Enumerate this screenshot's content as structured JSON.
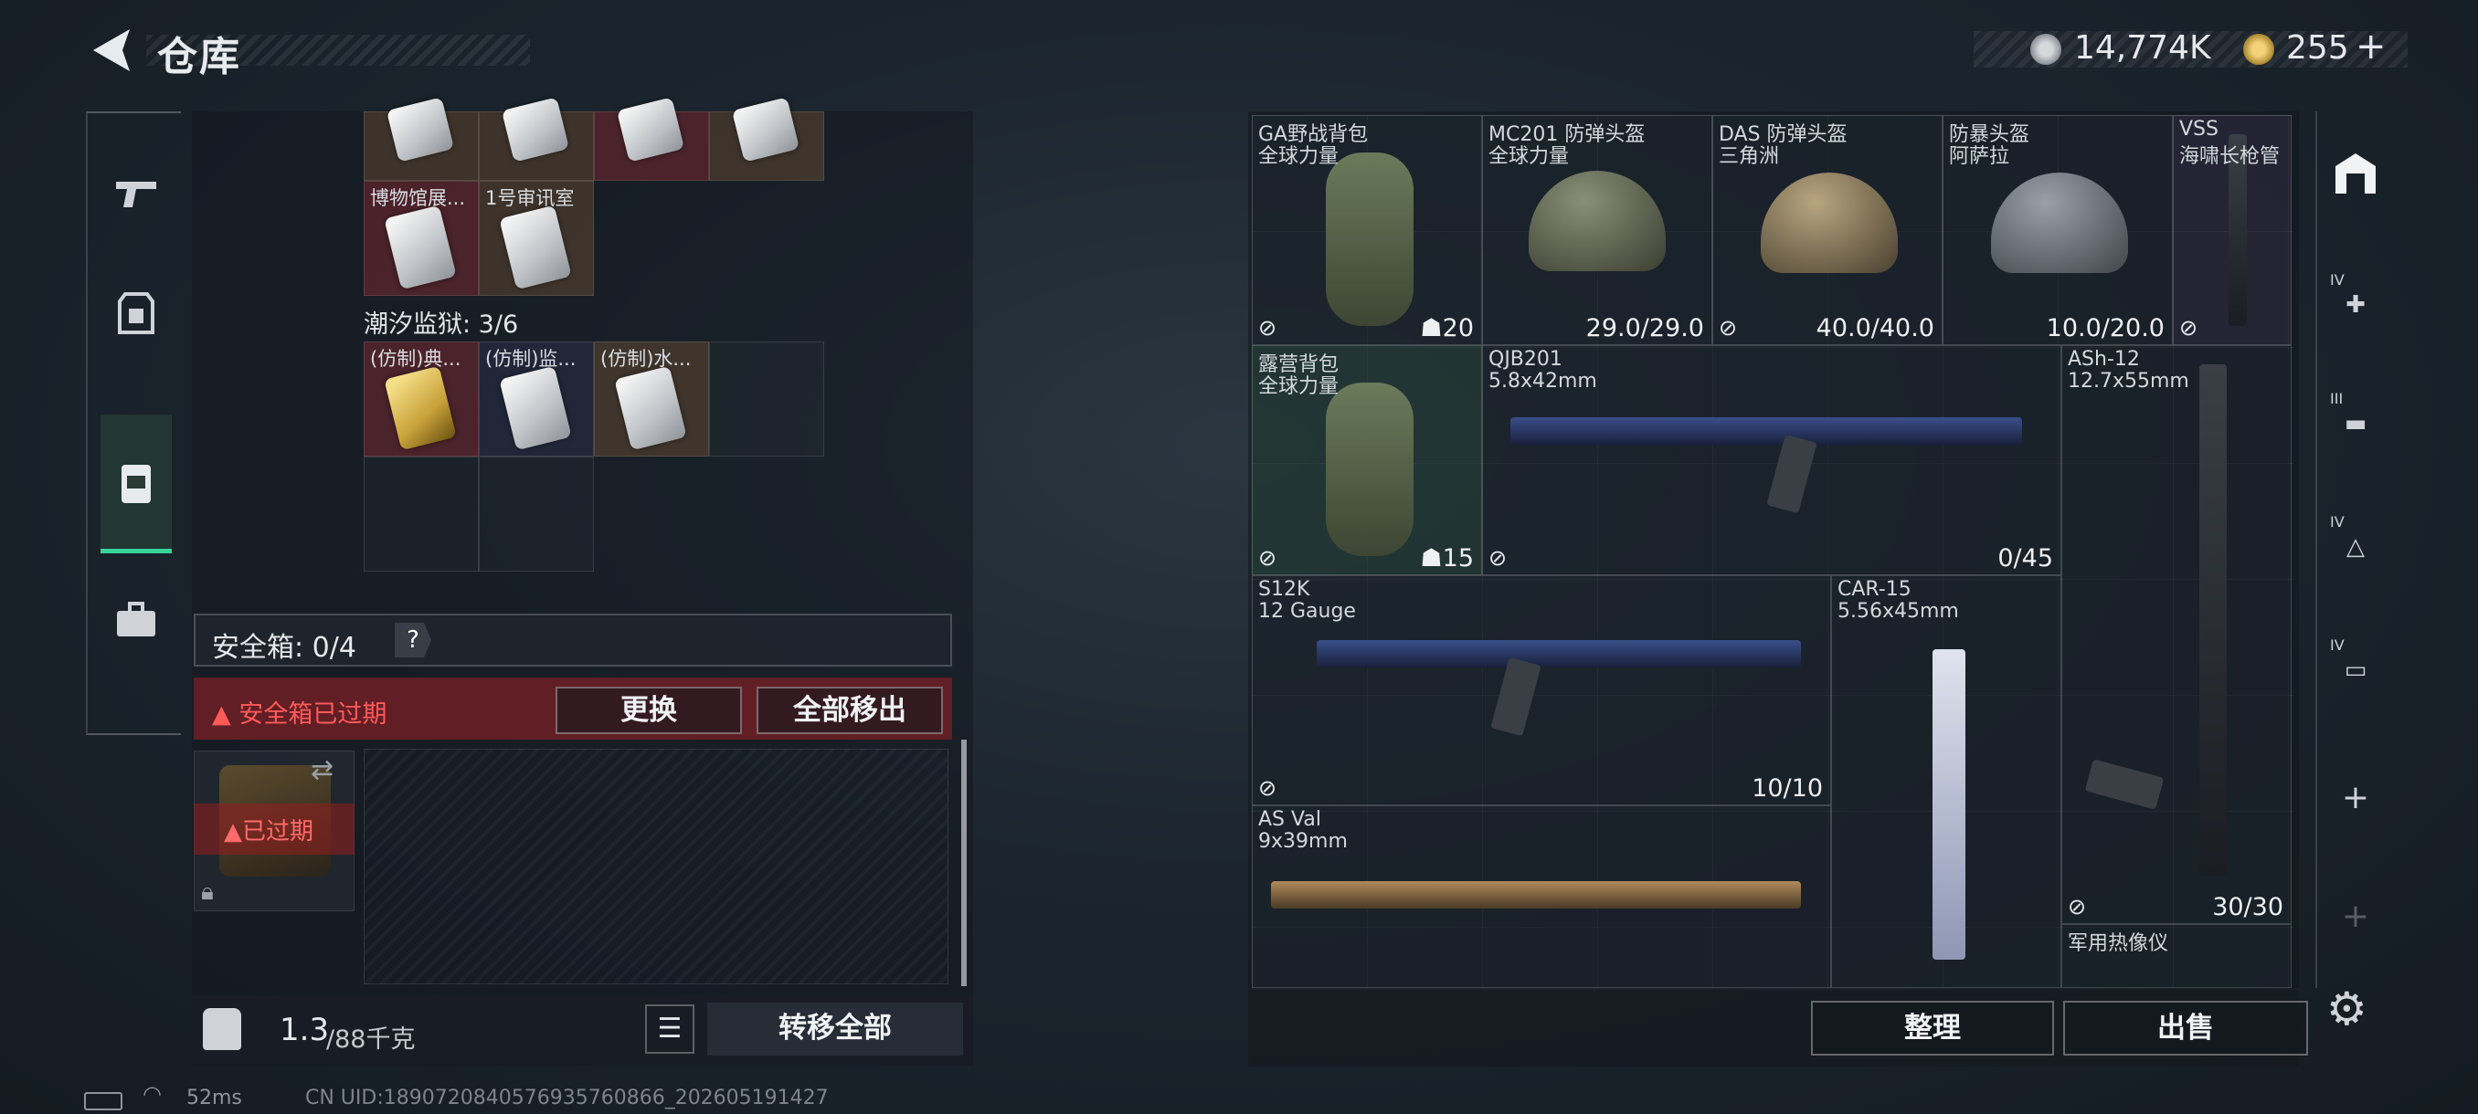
{
  "header": {
    "title": "仓库",
    "currency": {
      "money": "14,774K",
      "coins": "255",
      "plus": "+"
    }
  },
  "left_panel": {
    "top_row_cells": [
      {
        "label": "",
        "color": "brown"
      },
      {
        "label": "",
        "color": "brown"
      },
      {
        "label": "",
        "color": "red"
      },
      {
        "label": "",
        "color": "brown"
      }
    ],
    "second_row_cells": [
      {
        "label": "博物馆展...",
        "color": "red"
      },
      {
        "label": "1号审讯室",
        "color": "brown"
      }
    ],
    "prison_label": "潮汐监狱: 3/6",
    "prison_cells": [
      {
        "label": "(仿制)典...",
        "color": "red"
      },
      {
        "label": "(仿制)监...",
        "color": "blue"
      },
      {
        "label": "(仿制)水...",
        "color": "brown"
      }
    ],
    "safebox": {
      "label": "安全箱: 0/4",
      "help": "?",
      "warning": "安全箱已过期",
      "replace": "更换",
      "move_all": "全部移出",
      "expired": "已过期"
    },
    "bottom": {
      "weight": "1.3",
      "weight_max": "/88千克",
      "transfer_all": "转移全部"
    }
  },
  "status": {
    "ping": "52ms",
    "uid": "CN UID:1890720840576935760866_202605191427"
  },
  "stash": {
    "items": [
      {
        "name": "GA野战背包",
        "sub": "全球力量",
        "cap": "20"
      },
      {
        "name": "MC201 防弹头盔",
        "sub": "全球力量",
        "dura": "29.0/29.0"
      },
      {
        "name": "DAS 防弹头盔",
        "sub": "三角洲",
        "dura": "40.0/40.0"
      },
      {
        "name": "防暴头盔",
        "sub": "阿萨拉",
        "dura": "10.0/20.0"
      },
      {
        "name": "VSS",
        "sub": "海啸长枪管"
      },
      {
        "name": "露营背包",
        "sub": "全球力量",
        "cap": "15"
      },
      {
        "name": "QJB201",
        "sub": "5.8x42mm",
        "dura": "0/45"
      },
      {
        "name": "ASh-12",
        "sub": "12.7x55mm"
      },
      {
        "name": "S12K",
        "sub": "12 Gauge",
        "dura": "10/10"
      },
      {
        "name": "CAR-15",
        "sub": "5.56x45mm"
      },
      {
        "name": "AS Val",
        "sub": "9x39mm"
      },
      {
        "name": "",
        "sub": "",
        "dura": "30/30"
      },
      {
        "name": "军用热像仪",
        "sub": ""
      }
    ],
    "sort": "整理",
    "sell": "出售"
  },
  "right_tabs": [
    {
      "tier": "",
      "icon": "safe-house-icon"
    },
    {
      "tier": "IV",
      "icon": "medkit-icon"
    },
    {
      "tier": "III",
      "icon": "rifle-icon"
    },
    {
      "tier": "IV",
      "icon": "armor-icon"
    },
    {
      "tier": "IV",
      "icon": "case-icon"
    },
    {
      "tier": "",
      "icon": "plus-icon"
    },
    {
      "tier": "",
      "icon": "plus-icon"
    }
  ],
  "colors": {
    "accent_green": "#37d49a",
    "warning_red": "#ff5a5a"
  }
}
